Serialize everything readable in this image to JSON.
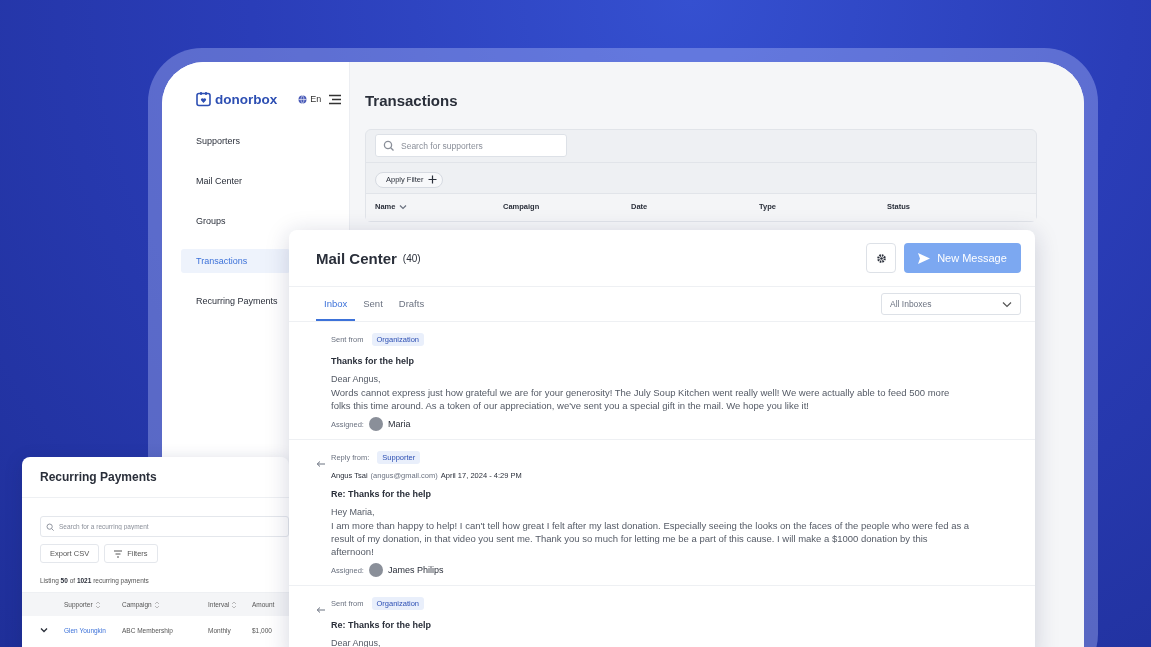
{
  "app": {
    "logo": "donorbox",
    "language": "En"
  },
  "sidebar": {
    "items": [
      {
        "label": "Supporters",
        "selected": false
      },
      {
        "label": "Mail Center",
        "selected": false
      },
      {
        "label": "Groups",
        "selected": false
      },
      {
        "label": "Transactions",
        "selected": true
      },
      {
        "label": "Recurring Payments",
        "selected": false
      }
    ]
  },
  "transactions": {
    "title": "Transactions",
    "search": {
      "placeholder": "Search for supporters"
    },
    "filter_button": "Apply Filter",
    "columns": [
      {
        "label": "Name",
        "sortable": true
      },
      {
        "label": "Campaign",
        "sortable": false
      },
      {
        "label": "Date",
        "sortable": false
      },
      {
        "label": "Type",
        "sortable": false
      },
      {
        "label": "Status",
        "sortable": false
      }
    ]
  },
  "mail_center": {
    "title": "Mail Center",
    "count": "(40)",
    "new_message_button": "New Message",
    "tabs": [
      {
        "label": "Inbox",
        "selected": true
      },
      {
        "label": "Sent",
        "selected": false
      },
      {
        "label": "Drafts",
        "selected": false
      }
    ],
    "inbox_filter": "All Inboxes",
    "messages": [
      {
        "threaded": false,
        "origin_label": "Sent from",
        "origin_tag": "Organization",
        "subject": "Thanks for the help",
        "greeting": "Dear Angus,",
        "body": "Words cannot express just how grateful we are for your generosity! The July Soup Kitchen went really well! We were actually able to feed 500 more folks this time around. As a token of our appreciation, we've sent you a special gift in the mail. We hope you like it!",
        "assigned_label": "Assigned:",
        "assignee": "Maria"
      },
      {
        "threaded": true,
        "origin_label": "Reply from:",
        "origin_tag": "Supporter",
        "sender": {
          "name": "Angus Tsai",
          "email": "(angus@gmail.com)",
          "date": "April 17, 2024 - 4:29 PM"
        },
        "subject": "Re: Thanks for the help",
        "greeting": "Hey Maria,",
        "body": "I am more than happy to help! I can't tell how great I felt after my last donation. Especially seeing the looks on the faces of the people who were fed as a result of my donation, in that video you sent me. Thank you so much for letting me be a part of this cause. I will make a $1000 donation by this afternoon!",
        "assigned_label": "Assigned:",
        "assignee": "James Philips"
      },
      {
        "threaded": true,
        "origin_label": "Sent from",
        "origin_tag": "Organization",
        "subject": "Re: Thanks for the help",
        "greeting": "Dear Angus,"
      }
    ]
  },
  "recurring_payments": {
    "title": "Recurring Payments",
    "search": {
      "placeholder": "Search for a recurring payment"
    },
    "export_button": "Export CSV",
    "filters_button": "Filters",
    "listing": "Listing **50** of **1021** recurring payments",
    "columns": [
      "Supporter",
      "Campaign",
      "Interval",
      "Amount"
    ],
    "rows": [
      {
        "expanded": false,
        "cells": [
          "Glen Youngkin",
          "ABC Membership",
          "Monthly",
          "$1,000"
        ]
      }
    ]
  }
}
